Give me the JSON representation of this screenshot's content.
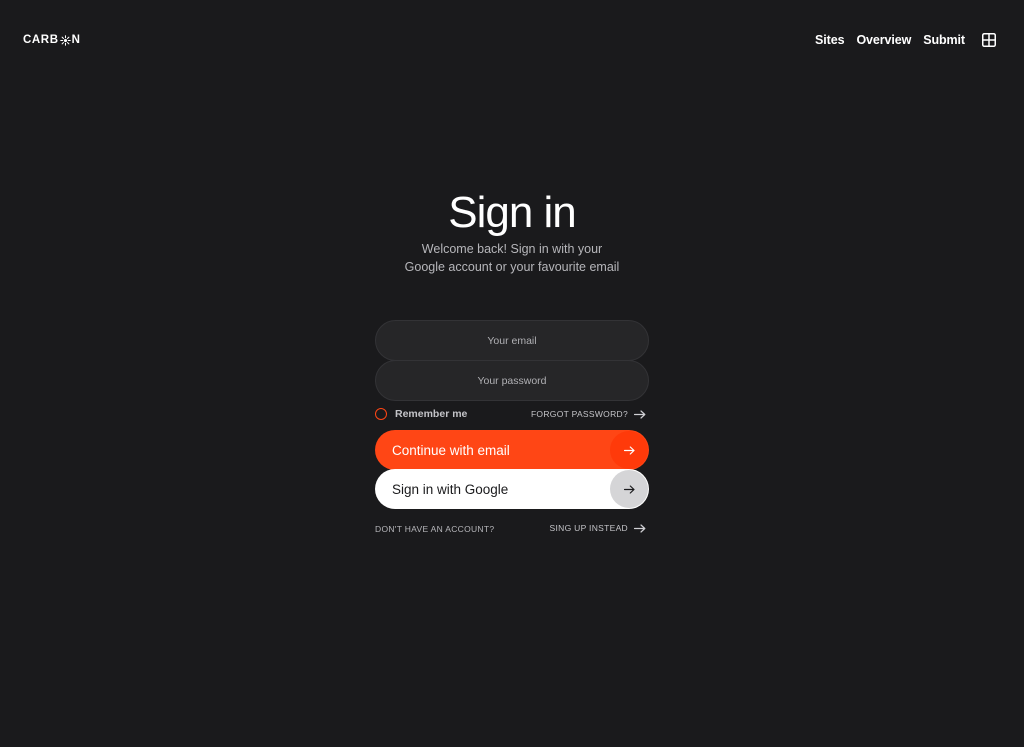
{
  "header": {
    "logo_left": "CARB",
    "logo_right": "N",
    "nav": [
      {
        "label": "Sites"
      },
      {
        "label": "Overview"
      },
      {
        "label": "Submit"
      }
    ],
    "menu_icon": "grid-icon"
  },
  "main": {
    "title": "Sign in",
    "subtitle_line1": "Welcome back! Sign in with your",
    "subtitle_line2": "Google account or your favourite email"
  },
  "form": {
    "email_placeholder": "Your email",
    "email_value": "",
    "password_placeholder": "Your password",
    "password_value": "",
    "remember_label": "Remember me",
    "remember_checked": false,
    "forgot_label": "FORGOT PASSWORD?",
    "continue_email_label": "Continue with email",
    "google_label": "Sign in with Google",
    "no_account_label": "DON'T HAVE AN ACCOUNT?",
    "signup_label": "SING UP INSTEAD"
  },
  "colors": {
    "background": "#1a1a1c",
    "accent": "#ff4615",
    "field_bg": "#262628",
    "text_muted": "#b6b6ba"
  },
  "icons": [
    "sun-icon",
    "grid-icon",
    "arrow-right-icon"
  ]
}
